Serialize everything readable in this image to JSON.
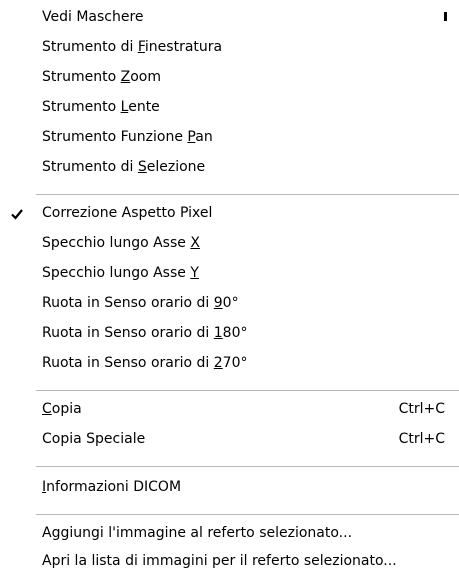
{
  "menu": {
    "items": [
      {
        "id": "vedi-maschere",
        "label": "Vedi Maschere",
        "has_submenu": true
      },
      {
        "id": "strumento-finestratura",
        "pre": "Strumento di ",
        "u": "F",
        "post": "inestratura"
      },
      {
        "id": "strumento-zoom",
        "pre": "Strumento ",
        "u": "Z",
        "post": "oom"
      },
      {
        "id": "strumento-lente",
        "pre": "Strumento ",
        "u": "L",
        "post": "ente"
      },
      {
        "id": "strumento-pan",
        "pre": "Strumento Funzione ",
        "u": "P",
        "post": "an"
      },
      {
        "id": "strumento-selezione",
        "pre": "Strumento di ",
        "u": "S",
        "post": "elezione"
      },
      {
        "id": "correzione-aspetto",
        "label": "Correzione Aspetto Pixel",
        "checked": true
      },
      {
        "id": "specchio-x",
        "pre": "Specchio lungo Asse ",
        "u": "X",
        "post": ""
      },
      {
        "id": "specchio-y",
        "pre": "Specchio lungo Asse ",
        "u": "Y",
        "post": ""
      },
      {
        "id": "ruota-90",
        "pre": "Ruota in Senso orario di ",
        "u": "9",
        "post": "0°"
      },
      {
        "id": "ruota-180",
        "pre": "Ruota in Senso orario di ",
        "u": "1",
        "post": "80°"
      },
      {
        "id": "ruota-270",
        "pre": "Ruota in Senso orario di ",
        "u": "2",
        "post": "70°"
      },
      {
        "id": "copia",
        "pre": "",
        "u": "C",
        "post": "opia",
        "shortcut": "Ctrl+C"
      },
      {
        "id": "copia-speciale",
        "label": "Copia Speciale",
        "shortcut": "Ctrl+C"
      },
      {
        "id": "informazioni-dicom",
        "pre": "",
        "u": "I",
        "post": "nformazioni DICOM"
      },
      {
        "id": "aggiungi-immagine",
        "label": "Aggiungi l'immagine al referto selezionato..."
      },
      {
        "id": "apri-lista",
        "label": "Apri la lista di immagini per il referto selezionato..."
      }
    ]
  }
}
